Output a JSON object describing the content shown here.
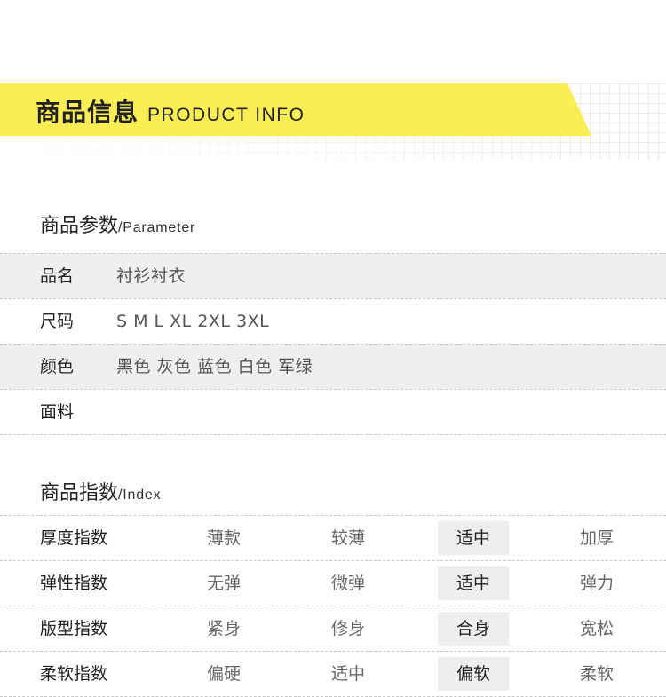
{
  "header": {
    "title_cn": "商品信息",
    "title_en": "PRODUCT INFO"
  },
  "parameter_section": {
    "title_cn": "商品参数",
    "title_en": "/Parameter",
    "rows": [
      {
        "label": "品名",
        "value": "衬衫衬衣"
      },
      {
        "label": "尺码",
        "value": "S M L XL 2XL 3XL"
      },
      {
        "label": "颜色",
        "value": "黑色 灰色 蓝色 白色 军绿"
      },
      {
        "label": "面料",
        "value": ""
      }
    ]
  },
  "index_section": {
    "title_cn": "商品指数",
    "title_en": "/Index",
    "rows": [
      {
        "label": "厚度指数",
        "options": [
          "薄款",
          "较薄",
          "适中",
          "加厚"
        ],
        "selected": 2
      },
      {
        "label": "弹性指数",
        "options": [
          "无弹",
          "微弹",
          "适中",
          "弹力"
        ],
        "selected": 2
      },
      {
        "label": "版型指数",
        "options": [
          "紧身",
          "修身",
          "合身",
          "宽松"
        ],
        "selected": 2
      },
      {
        "label": "柔软指数",
        "options": [
          "偏硬",
          "适中",
          "偏软",
          "柔软"
        ],
        "selected": 2
      }
    ]
  },
  "colors": {
    "accent_yellow": "#fbee55",
    "selected_bg": "#eeeeee",
    "row_shade": "#efefef"
  }
}
